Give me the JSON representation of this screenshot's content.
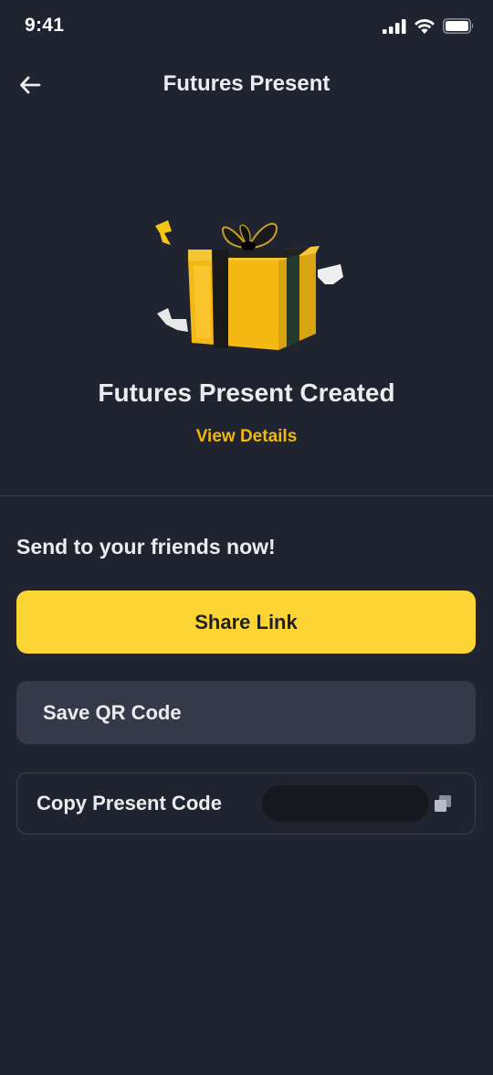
{
  "status_bar": {
    "time": "9:41"
  },
  "header": {
    "title": "Futures Present",
    "back_icon": "arrow-left-icon"
  },
  "hero": {
    "illustration": "gift-box-icon",
    "title": "Futures Present Created",
    "view_details_label": "View Details"
  },
  "share_section": {
    "title": "Send to your friends now!",
    "share_link_label": "Share Link",
    "save_qr_label": "Save QR Code",
    "copy_code_label": "Copy Present Code",
    "copy_icon": "copy-icon"
  },
  "colors": {
    "background": "#1f2430",
    "accent": "#fcd535",
    "link": "#f0b90b",
    "secondary_button": "#343a48"
  }
}
